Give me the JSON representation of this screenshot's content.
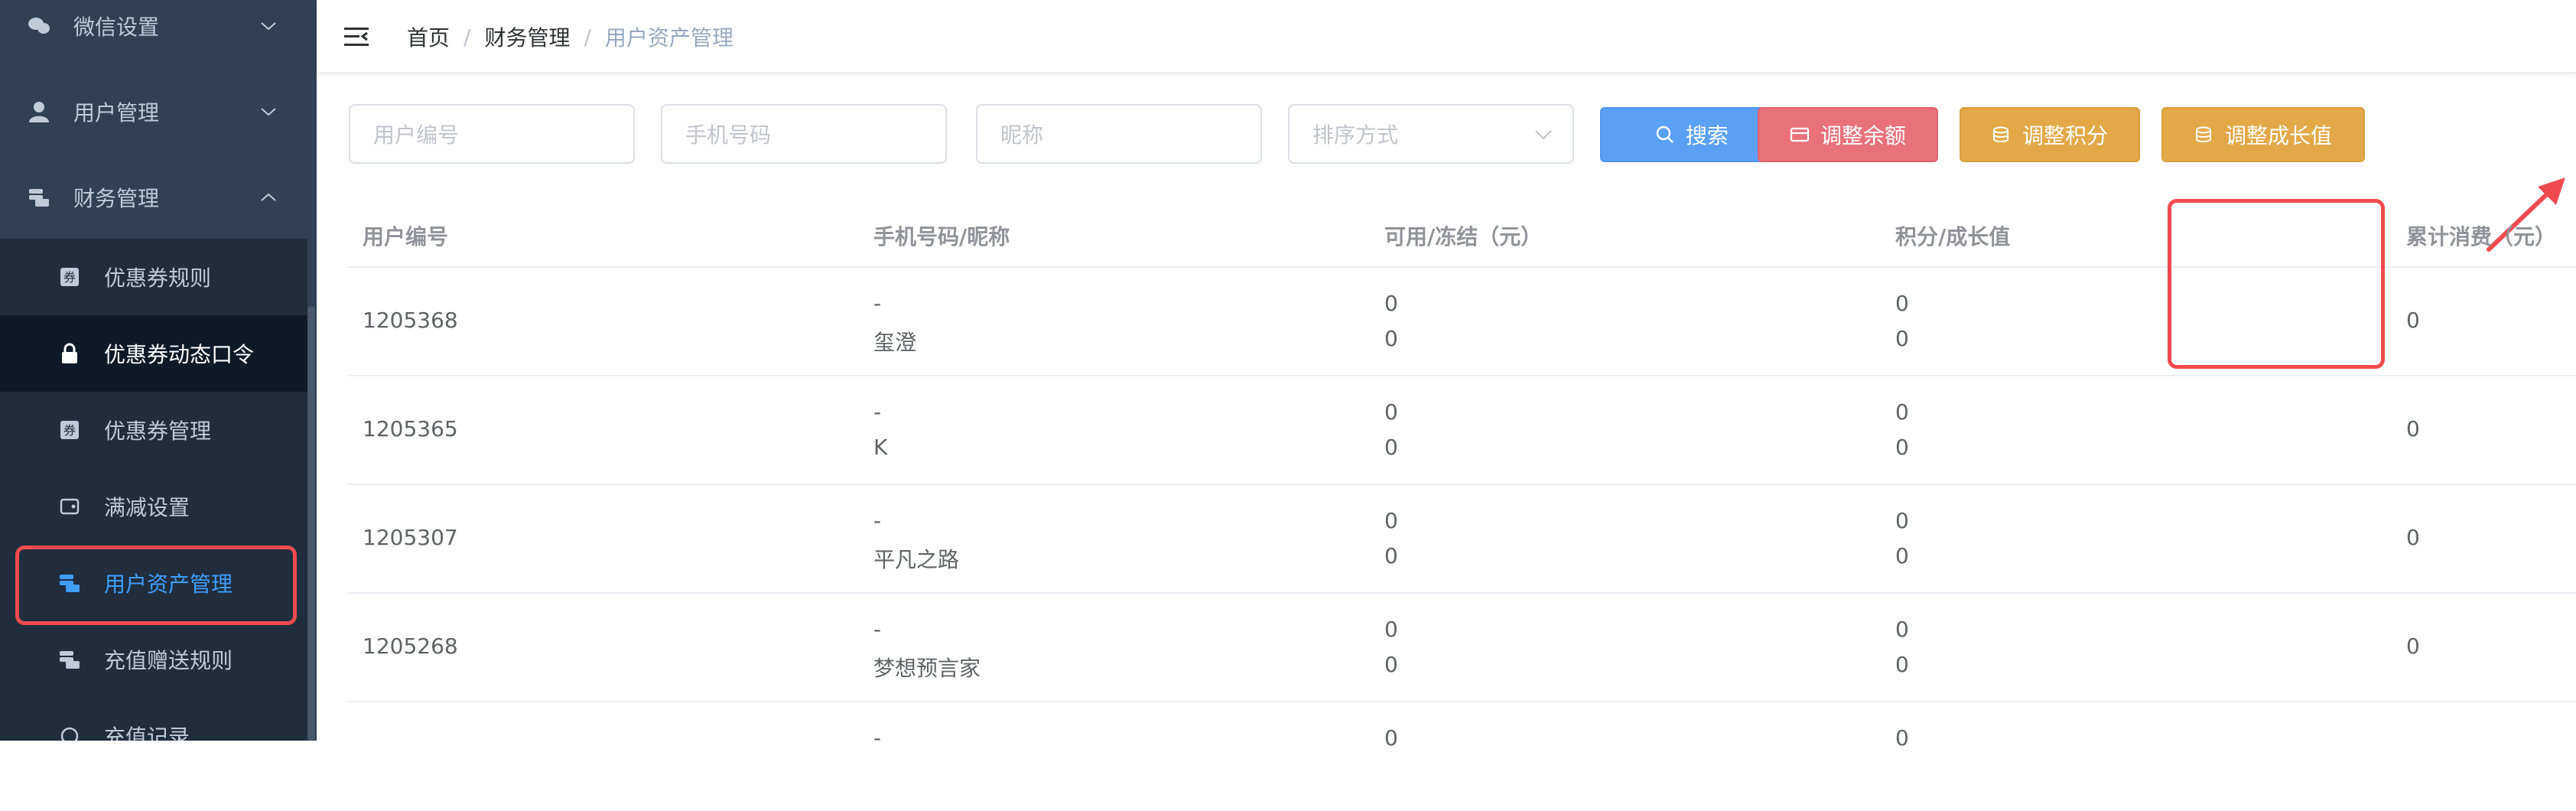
{
  "sidebar": {
    "items": [
      {
        "label": "微信设置",
        "icon": "wechat-icon"
      },
      {
        "label": "用户管理",
        "icon": "user-icon"
      },
      {
        "label": "财务管理",
        "icon": "coins-icon"
      },
      {
        "label": "优惠券规则",
        "icon": "coupon-icon"
      },
      {
        "label": "优惠券动态口令",
        "icon": "lock-icon"
      },
      {
        "label": "优惠券管理",
        "icon": "coupon-icon"
      },
      {
        "label": "满减设置",
        "icon": "wallet-icon"
      },
      {
        "label": "用户资产管理",
        "icon": "coins-icon"
      },
      {
        "label": "充值赠送规则",
        "icon": "coins-icon"
      },
      {
        "label": "充值记录",
        "icon": "money-icon"
      }
    ],
    "active_color": "#409eff"
  },
  "breadcrumb": [
    "首页",
    "财务管理",
    "用户资产管理"
  ],
  "filters": {
    "user_id_placeholder": "用户编号",
    "phone_placeholder": "手机号码",
    "nickname_placeholder": "昵称",
    "sort_placeholder": "排序方式"
  },
  "buttons": {
    "search": "搜索",
    "adjust_balance": "调整余额",
    "adjust_points": "调整积分",
    "adjust_growth": "调整成长值"
  },
  "colors": {
    "search": "#5aa0f7",
    "danger": "#e9727a",
    "warning": "#e3a948",
    "annotation": "#ef4b4f"
  },
  "table": {
    "headers": [
      "用户编号",
      "手机号码/昵称",
      "可用/冻结（元）",
      "积分/成长值",
      "累计消费（元）"
    ],
    "rows": [
      {
        "id": "1205368",
        "phone": "-",
        "nickname": "玺澄",
        "available": "0",
        "frozen": "0",
        "points": "0",
        "growth": "0",
        "total": "0"
      },
      {
        "id": "1205365",
        "phone": "-",
        "nickname": "K",
        "available": "0",
        "frozen": "0",
        "points": "0",
        "growth": "0",
        "total": "0"
      },
      {
        "id": "1205307",
        "phone": "-",
        "nickname": "平凡之路",
        "available": "0",
        "frozen": "0",
        "points": "0",
        "growth": "0",
        "total": "0"
      },
      {
        "id": "1205268",
        "phone": "-",
        "nickname": "梦想预言家",
        "available": "0",
        "frozen": "0",
        "points": "0",
        "growth": "0",
        "total": "0"
      },
      {
        "id": "",
        "phone": "-",
        "nickname": "",
        "available": "0",
        "frozen": "",
        "points": "0",
        "growth": "",
        "total": ""
      }
    ]
  }
}
